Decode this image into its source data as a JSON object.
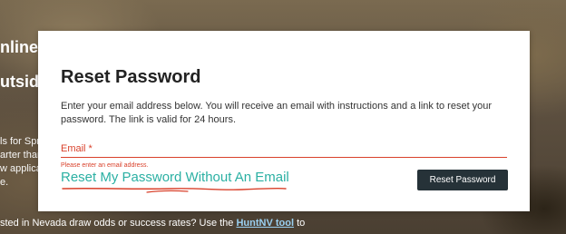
{
  "background": {
    "heading_line_1": "nline",
    "heading_line_2": "utside",
    "text_line_1": "ls for Spri",
    "text_line_2": "arter than",
    "text_line_3": "w applica",
    "text_line_4": "e.",
    "bottom_text": "sted in Nevada draw odds or success rates? Use the ",
    "bottom_link": "HuntNV tool",
    "bottom_suffix": " to"
  },
  "modal": {
    "title": "Reset Password",
    "description": "Enter your email address below. You will receive an email with instructions and a link to reset your password. The link is valid for 24 hours.",
    "email_label": "Email *",
    "email_value": "",
    "email_error": "Please enter an email address.",
    "no_email_link": "Reset My Password Without An Email",
    "reset_button": "Reset Password"
  },
  "colors": {
    "error": "#d9412b",
    "link": "#2bb0a3",
    "button_bg": "#263238"
  }
}
